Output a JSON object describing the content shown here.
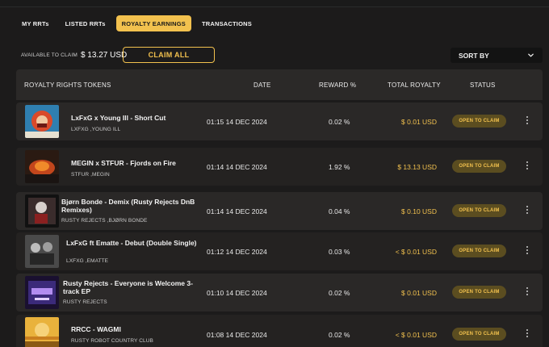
{
  "tabs": [
    {
      "label": "MY RRTs",
      "active": false
    },
    {
      "label": "LISTED RRTs",
      "active": false
    },
    {
      "label": "ROYALTY EARNINGS",
      "active": true
    },
    {
      "label": "TRANSACTIONS",
      "active": false
    }
  ],
  "claim_bar": {
    "label": "AVAILABLE TO CLAIM",
    "amount": "$ 13.27 USD",
    "button": "CLAIM ALL"
  },
  "sort": {
    "label": "SORT BY",
    "icon": "chevron-down-icon"
  },
  "columns": {
    "token": "ROYALTY RIGHTS TOKENS",
    "date": "DATE",
    "reward": "REWARD %",
    "total": "TOTAL ROYALTY",
    "status": "STATUS"
  },
  "rows": [
    {
      "title": "LxFxG x Young Ill - Short Cut",
      "artist": "LXFXG ,YOUNG ILL",
      "date": "01:15 14 DEC 2024",
      "reward": "0.02 %",
      "total": "$ 0.01 USD",
      "status": "OPEN TO CLAIM"
    },
    {
      "title": "MEGIN x STFUR - Fjords on Fire",
      "artist": "STFUR ,MEGIN",
      "date": "01:14 14 DEC 2024",
      "reward": "1.92 %",
      "total": "$ 13.13 USD",
      "status": "OPEN TO CLAIM"
    },
    {
      "title": "Bjørn Bonde - Demix (Rusty Rejects DnB Remixes)",
      "artist": "RUSTY REJECTS ,BJØRN BONDE",
      "date": "01:14 14 DEC 2024",
      "reward": "0.04 %",
      "total": "$ 0.10 USD",
      "status": "OPEN TO CLAIM"
    },
    {
      "title": "LxFxG ft Ematte - Debut (Double Single)",
      "artist": "LXFXG ,EMATTE",
      "date": "01:12 14 DEC 2024",
      "reward": "0.03 %",
      "total": "< $ 0.01 USD",
      "status": "OPEN TO CLAIM"
    },
    {
      "title": "Rusty Rejects - Everyone is Welcome 3-track EP",
      "artist": "RUSTY REJECTS",
      "date": "01:10 14 DEC 2024",
      "reward": "0.02 %",
      "total": "$ 0.01 USD",
      "status": "OPEN TO CLAIM"
    },
    {
      "title": "RRCC - WAGMI",
      "artist": "RUSTY ROBOT COUNTRY CLUB",
      "date": "01:08 14 DEC 2024",
      "reward": "0.02 %",
      "total": "< $ 0.01 USD",
      "status": "OPEN TO CLAIM"
    }
  ],
  "colors": {
    "accent": "#f2c14e",
    "status_bg": "#5b4d20",
    "row_bg": "#2a2827",
    "page_bg": "#1c1b1b"
  }
}
